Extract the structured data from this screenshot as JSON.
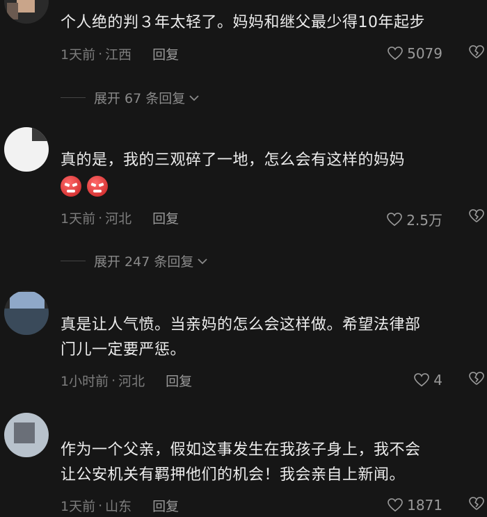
{
  "comments": [
    {
      "text": "个人绝的判３年太轻了。妈妈和继父最少得10年起步",
      "time": "1天前",
      "location": "江西",
      "reply_label": "回复",
      "likes": "5079",
      "expand_label": "展开 67 条回复"
    },
    {
      "text": "真的是，我的三观碎了一地，怎么会有这样的妈妈",
      "emojis": [
        "angry-emoji",
        "angry-emoji"
      ],
      "time": "1天前",
      "location": "河北",
      "reply_label": "回复",
      "likes": "2.5万",
      "expand_label": "展开 247 条回复"
    },
    {
      "text_line1": "真是让人气愤。当亲妈的怎么会这样做。希望法律部",
      "text_line2": "门儿一定要严惩。",
      "time": "1小时前",
      "location": "河北",
      "reply_label": "回复",
      "likes": "4"
    },
    {
      "text_line1": "作为一个父亲，假如这事发生在我孩子身上，我不会",
      "text_line2": "让公安机关有羁押他们的机会！我会亲自上新闻。",
      "time": "1天前",
      "location": "山东",
      "reply_label": "回复",
      "likes": "1871"
    }
  ],
  "meta_separator": "·",
  "colors": {
    "background": "#161616",
    "text": "#ececec",
    "meta": "#7d7d7d"
  }
}
